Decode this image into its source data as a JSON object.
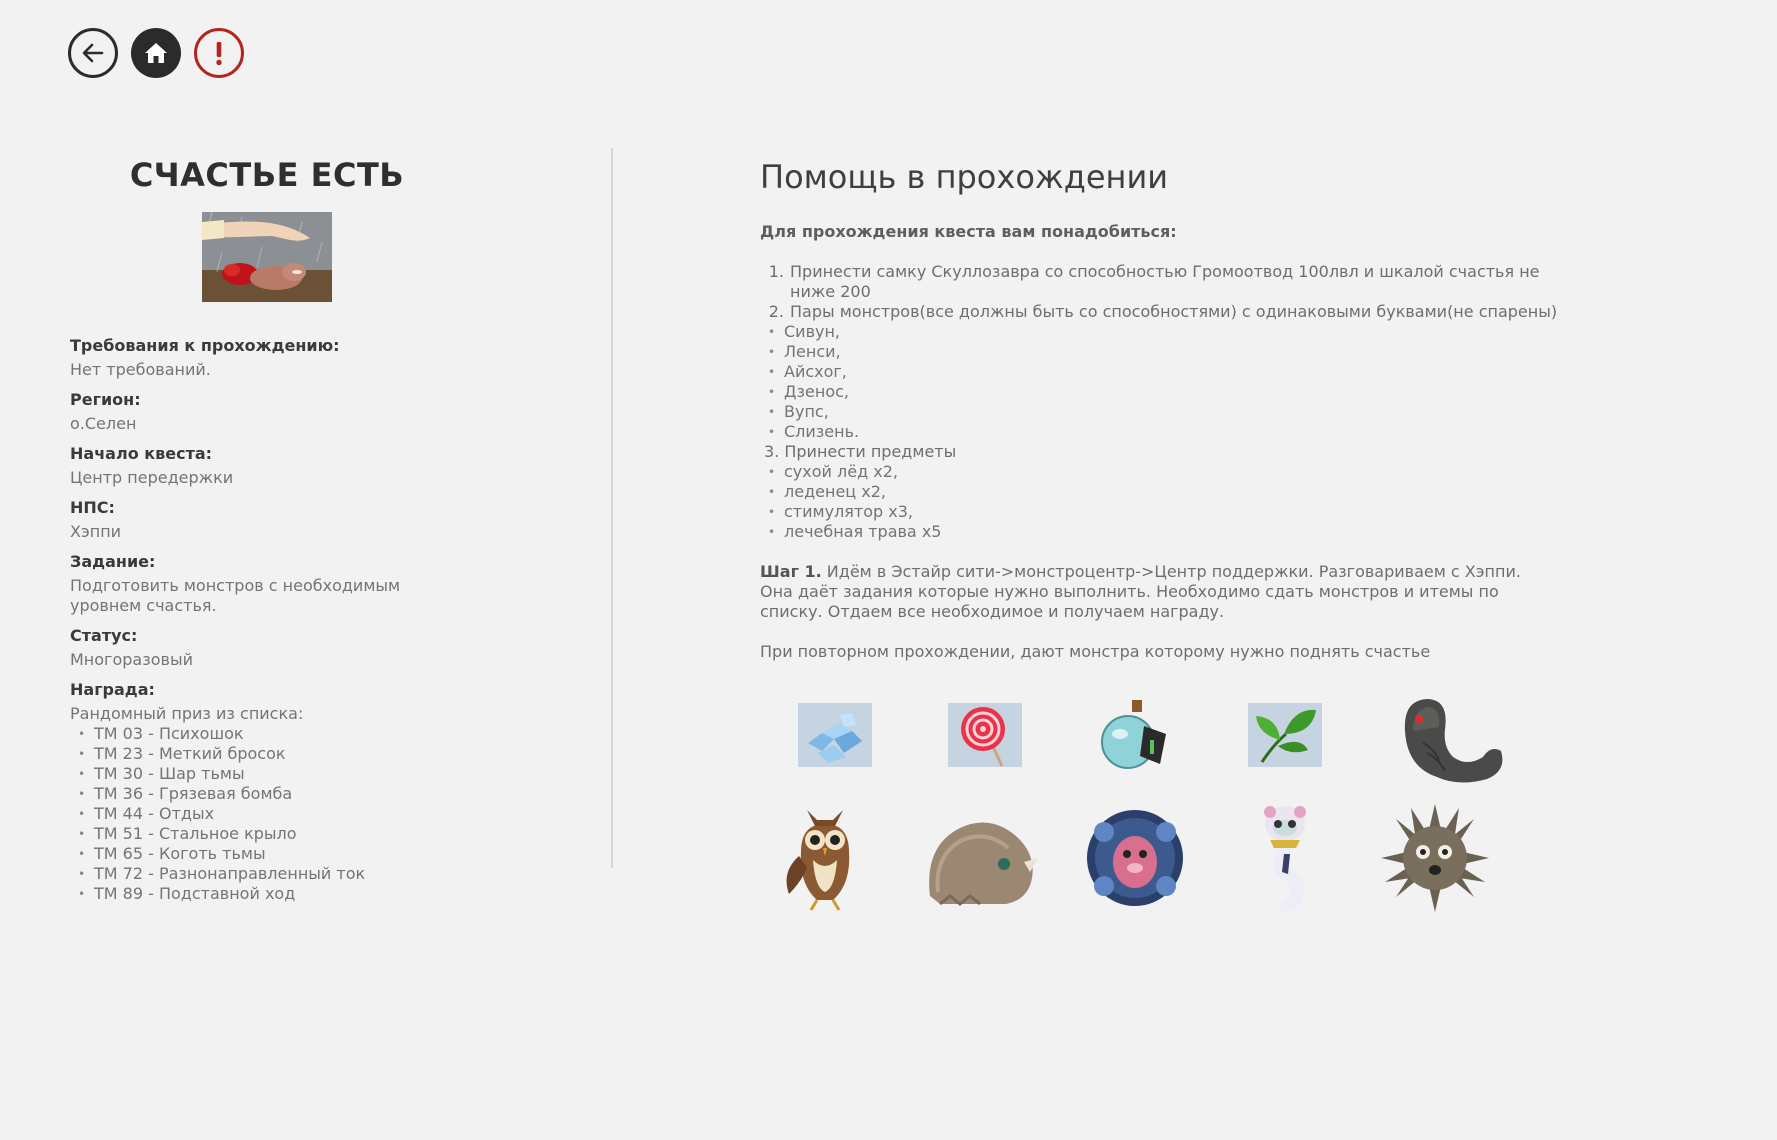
{
  "nav": {
    "back_icon": "arrow-left-icon",
    "home_icon": "home-icon",
    "alert_icon": "exclamation-icon"
  },
  "quest": {
    "title": "СЧАСТЬЕ ЕСТЬ",
    "requirements_label": "Требования к прохождению:",
    "requirements_value": "Нет требований.",
    "region_label": "Регион:",
    "region_value": "о.Селен",
    "start_label": "Начало квеста:",
    "start_value": "Центр передержки",
    "npc_label": "НПС:",
    "npc_value": "Хэппи",
    "task_label": "Задание:",
    "task_value": "Подготовить монстров с необходимым уровнем счастья.",
    "status_label": "Статус:",
    "status_value": "Многоразовый",
    "reward_label": "Награда:",
    "reward_intro": "Рандомный приз из списка:",
    "rewards": [
      "ТМ 03 - Психошок",
      "ТМ 23 - Меткий бросок",
      "ТМ 30 - Шар тьмы",
      "ТМ 36 - Грязевая бомба",
      "ТМ 44 - Отдых",
      "ТМ 51 - Стальное крыло",
      "ТМ 65 - Коготь тьмы",
      "ТМ 72 - Разнонаправленный ток",
      "ТМ 89 - Подставной ход"
    ]
  },
  "help": {
    "title": "Помощь в прохождении",
    "need_heading": "Для прохождения квеста вам понадобиться:",
    "item1_num": "1.",
    "item1": "Принести самку Скуллозавра со способностью Громоотвод 100лвл и шкалой счастья не ниже 200",
    "item2_num": "2.",
    "item2": "Пары монстров(все должны быть со способностями) с одинаковыми буквами(не спарены)",
    "monsters": [
      "Сивун,",
      "Ленси,",
      "Айсхог,",
      "Дзенос,",
      "Вупс,",
      "Слизень."
    ],
    "item3": "3. Принести предметы",
    "items": [
      "сухой лёд x2,",
      "леденец x2,",
      "стимулятор x3,",
      "лечебная трава x5"
    ],
    "step_label": "Шаг 1.",
    "step_text": "Идём в Эстайр сити->монстроцентр->Центр поддержки. Разговариваем с Хэппи. Она даёт задания которые нужно выполнить. Необходимо сдать монстров и итемы по списку. Отдаем все необходимое и получаем награду.",
    "repeat_text": "При повторном прохождении, дают монстра которому нужно поднять счастье"
  },
  "images": {
    "row1": [
      "dry-ice-icon",
      "lollipop-icon",
      "stimulator-potion-icon",
      "healing-herb-icon",
      "worm-monster-icon"
    ],
    "row2": [
      "owl-monster-icon",
      "furry-beast-icon",
      "armored-monster-icon",
      "white-serpent-icon",
      "spiky-ball-icon"
    ]
  }
}
